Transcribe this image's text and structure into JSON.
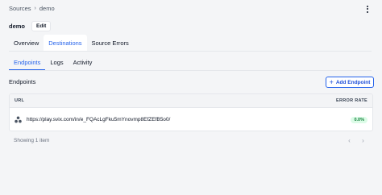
{
  "breadcrumb": {
    "root": "Sources",
    "separator": "›",
    "current": "demo"
  },
  "header": {
    "title": "demo",
    "edit_label": "Edit",
    "menu_icon": "kebab-icon"
  },
  "main_tabs": [
    {
      "label": "Overview",
      "active": false
    },
    {
      "label": "Destinations",
      "active": true
    },
    {
      "label": "Source Errors",
      "active": false
    }
  ],
  "sub_tabs": [
    {
      "label": "Endpoints",
      "active": true
    },
    {
      "label": "Logs",
      "active": false
    },
    {
      "label": "Activity",
      "active": false
    }
  ],
  "endpoints": {
    "title": "Endpoints",
    "add_label": "Add Endpoint",
    "add_icon": "plus-icon",
    "columns": {
      "url": "URL",
      "error_rate": "ERROR RATE"
    },
    "rows": [
      {
        "url": "https://play.svix.com/in/e_FQAcLgFku5mYnovmp8EfZEfB5o0/",
        "error_rate": "0.0%",
        "icon": "endpoint-icon"
      }
    ],
    "footer": "Showing 1 item",
    "prev_icon": "chevron-left-icon",
    "next_icon": "chevron-right-icon"
  },
  "colors": {
    "accent": "#2563eb",
    "background": "#f4f5f7",
    "success_bg": "#dcfce7",
    "success_text": "#15803d"
  }
}
